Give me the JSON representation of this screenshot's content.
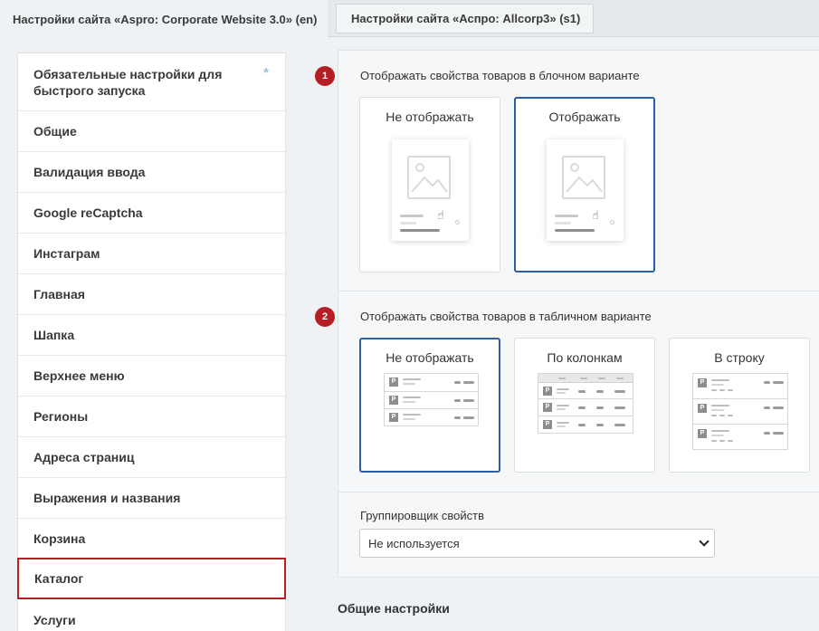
{
  "tabs": [
    {
      "label": "Настройки сайта «Aspro: Corporate Website 3.0» (en)"
    },
    {
      "label": "Настройки сайта «Аспро: Allcorp3» (s1)"
    }
  ],
  "sidebar": {
    "items": [
      {
        "label": "Обязательные настройки для быстрого запуска",
        "marker": "*"
      },
      {
        "label": "Общие"
      },
      {
        "label": "Валидация ввода"
      },
      {
        "label": "Google reCaptcha"
      },
      {
        "label": "Инстаграм"
      },
      {
        "label": "Главная"
      },
      {
        "label": "Шапка"
      },
      {
        "label": "Верхнее меню"
      },
      {
        "label": "Регионы"
      },
      {
        "label": "Адреса страниц"
      },
      {
        "label": "Выражения и названия"
      },
      {
        "label": "Корзина"
      },
      {
        "label": "Каталог"
      },
      {
        "label": "Услуги"
      }
    ],
    "selected": "Каталог"
  },
  "block_option": {
    "badge": "1",
    "label": "Отображать свойства товаров в блочном варианте",
    "choices": [
      {
        "label": "Не отображать",
        "selected": false
      },
      {
        "label": "Отображать",
        "selected": true
      }
    ]
  },
  "table_option": {
    "badge": "2",
    "label": "Отображать свойства товаров в табличном варианте",
    "choices": [
      {
        "label": "Не отображать",
        "selected": true
      },
      {
        "label": "По колонкам",
        "selected": false
      },
      {
        "label": "В строку",
        "selected": false
      }
    ]
  },
  "grouper": {
    "label": "Группировщик свойств",
    "value": "Не используется"
  },
  "section": {
    "title": "Общие настройки"
  },
  "colors": {
    "accent_red": "#b41f24",
    "selected_blue": "#2d5da8"
  }
}
